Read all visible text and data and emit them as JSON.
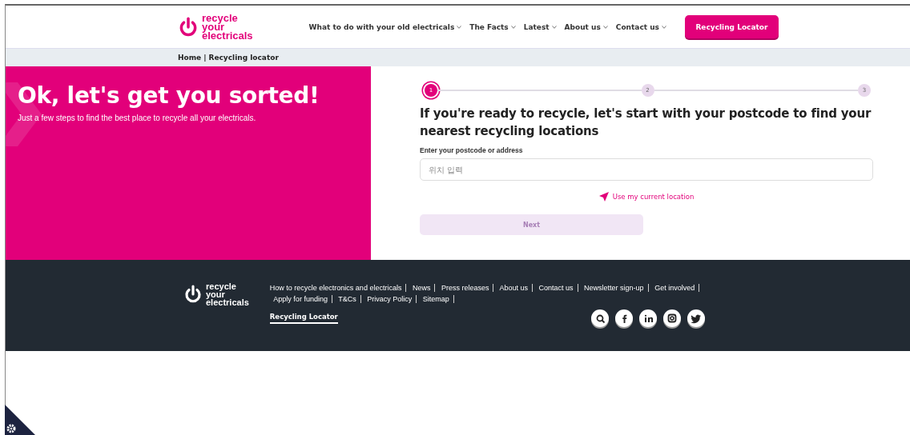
{
  "header": {
    "logo": [
      "recycle",
      "your",
      "electricals"
    ],
    "nav": [
      {
        "label": "What to do with your old electricals"
      },
      {
        "label": "The Facts"
      },
      {
        "label": "Latest"
      },
      {
        "label": "About us"
      },
      {
        "label": "Contact us"
      }
    ],
    "cta": "Recycling Locator"
  },
  "breadcrumb": {
    "home": "Home",
    "separator": "|",
    "current": "Recycling locator"
  },
  "hero": {
    "title": "Ok, let's get you sorted!",
    "subtitle": "Just a few steps to find the best place to recycle all your electricals."
  },
  "steps": [
    {
      "label": "1",
      "selected": true
    },
    {
      "label": "2",
      "selected": false
    },
    {
      "label": "3",
      "selected": false
    }
  ],
  "form": {
    "heading": "If you're ready to recycle, let's start with your postcode to find your nearest recycling locations",
    "field_label": "Enter your postcode or address",
    "placeholder": "위치 입력",
    "location_link": "Use my current location",
    "next": {
      "label": "Next",
      "disabled": true
    }
  },
  "footer": {
    "logo": [
      "recycle",
      "your",
      "electricals"
    ],
    "links": [
      "How to recycle electronics and electricals",
      "News",
      "Press releases",
      "About us",
      "Contact us",
      "Newsletter sign-up",
      "Get involved",
      "Apply for funding",
      "T&Cs",
      "Privacy Policy",
      "Sitemap"
    ],
    "locator": "Recycling Locator",
    "social": [
      {
        "kind": "search"
      },
      {
        "kind": "facebook"
      },
      {
        "kind": "linkedin"
      },
      {
        "kind": "instagram"
      },
      {
        "kind": "twitter"
      }
    ]
  }
}
